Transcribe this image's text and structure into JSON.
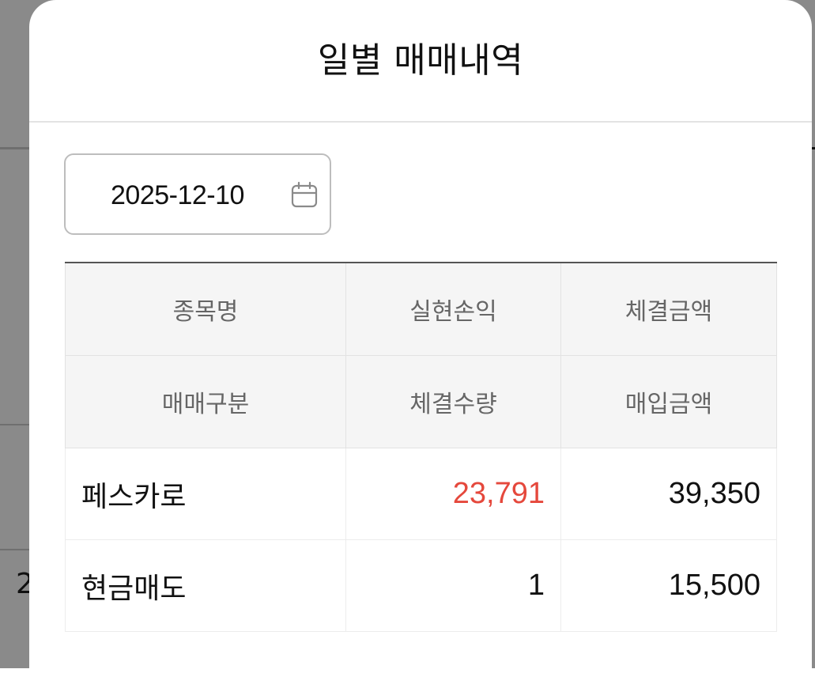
{
  "modal": {
    "title": "일별 매매내역"
  },
  "date_picker": {
    "value": "2025-12-10",
    "icon": "calendar-icon"
  },
  "table": {
    "headers": {
      "row1": [
        "종목명",
        "실현손익",
        "체결금액"
      ],
      "row2": [
        "매매구분",
        "체결수량",
        "매입금액"
      ]
    },
    "rows": [
      {
        "line1": [
          "페스카로",
          "23,791",
          "39,350"
        ],
        "line2": [
          "현금매도",
          "1",
          "15,500"
        ]
      }
    ],
    "profit_color": "#e5483c"
  },
  "background": {
    "partial_text": "2"
  }
}
